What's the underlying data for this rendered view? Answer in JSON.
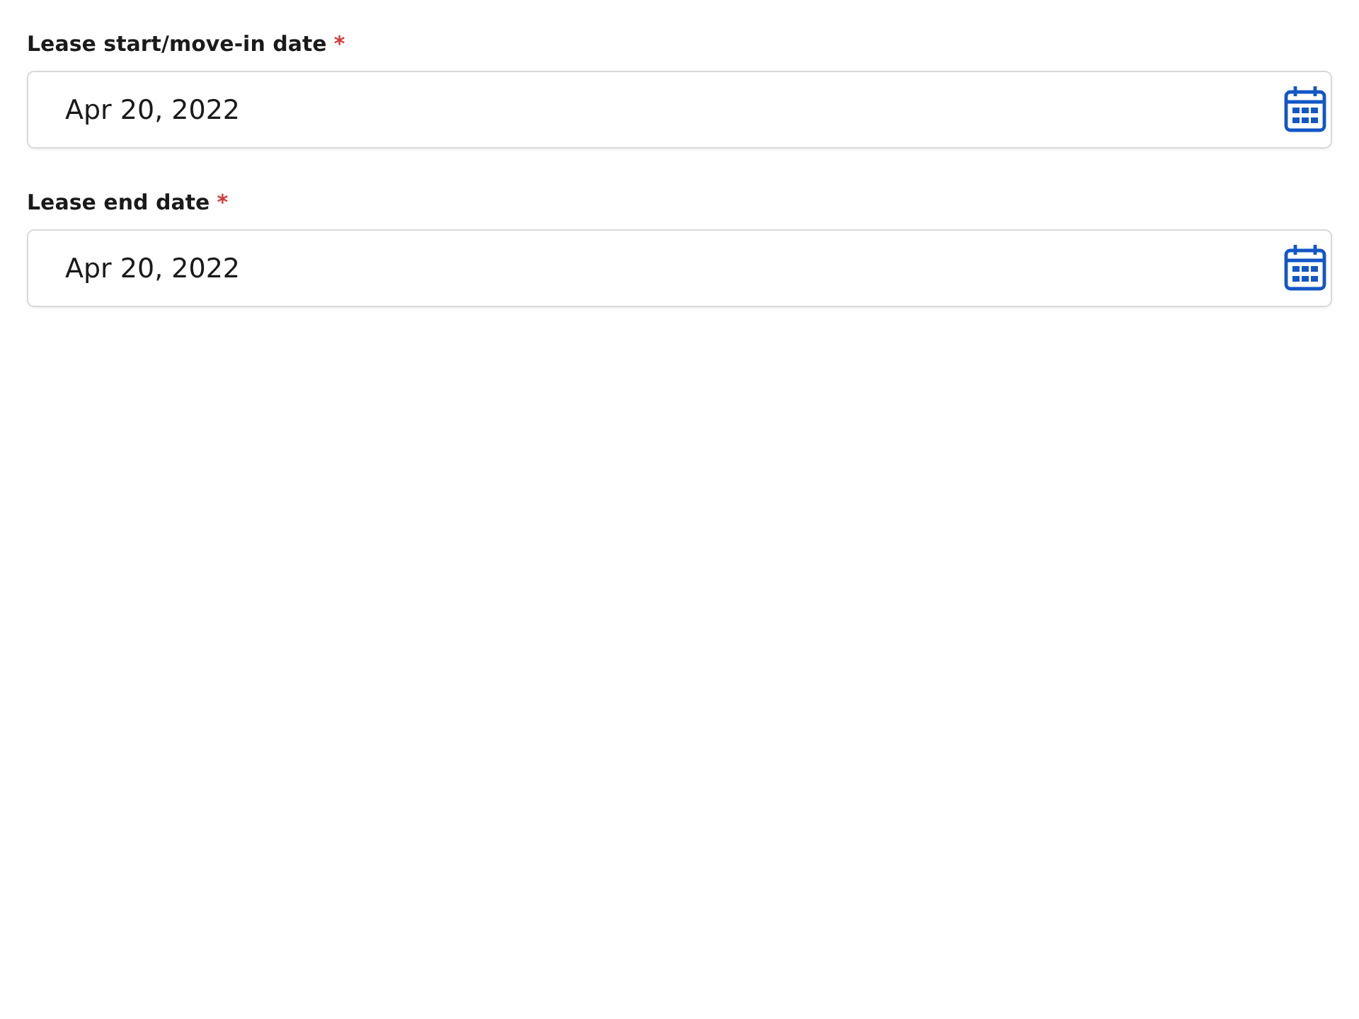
{
  "fields": [
    {
      "label": "Lease start/move-in date",
      "required_mark": "*",
      "value": "Apr 20, 2022"
    },
    {
      "label": "Lease end date",
      "required_mark": "*",
      "value": "Apr 20, 2022"
    }
  ]
}
